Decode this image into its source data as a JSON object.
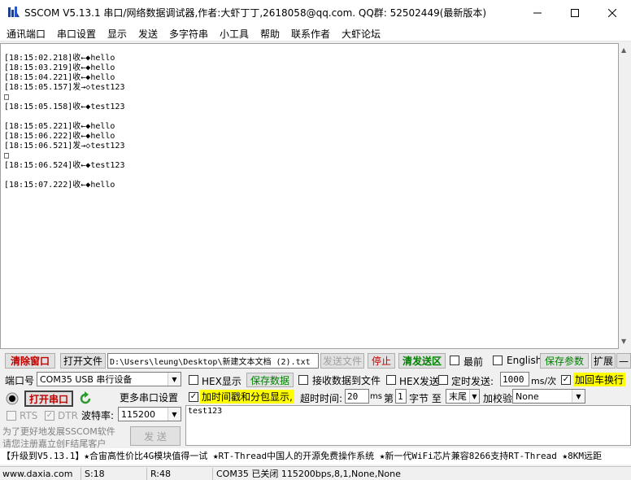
{
  "window": {
    "title": "SSCOM V5.13.1 串口/网络数据调试器,作者:大虾丁丁,2618058@qq.com. QQ群: 52502449(最新版本)",
    "minimize_icon": "minimize-icon",
    "maximize_icon": "maximize-icon",
    "close_icon": "close-icon"
  },
  "menu": [
    "通讯端口",
    "串口设置",
    "显示",
    "发送",
    "多字符串",
    "小工具",
    "帮助",
    "联系作者",
    "大虾论坛"
  ],
  "receive_lines": [
    "[18:15:02.218]收←◆hello",
    "[18:15:03.219]收←◆hello",
    "[18:15:04.221]收←◆hello",
    "[18:15:05.157]发→◇test123",
    "□",
    "[18:15:05.158]收←◆test123",
    "",
    "[18:15:05.221]收←◆hello",
    "[18:15:06.222]收←◆hello",
    "[18:15:06.521]发→◇test123",
    "□",
    "[18:15:06.524]收←◆test123",
    "",
    "[18:15:07.222]收←◆hello"
  ],
  "toolbar": {
    "clear_window": "清除窗口",
    "open_file": "打开文件",
    "file_path": "D:\\Users\\leung\\Desktop\\新建文本文档 (2).txt",
    "send_file": "发送文件",
    "stop": "停止",
    "clear_send": "清发送区",
    "topmost": "最前",
    "english": "English",
    "save_params": "保存参数",
    "expand": "扩展",
    "collapse": "—"
  },
  "port": {
    "port_label": "端口号",
    "port_value": "COM35 USB 串行设备",
    "open_port": "打开串口",
    "more_settings": "更多串口设置",
    "rts": "RTS",
    "dtr": "DTR",
    "baud_label": "波特率:",
    "baud_value": "115200",
    "promo_line1": "为了更好地发展SSCOM软件",
    "promo_line2": "请您注册嘉立创F结尾客户"
  },
  "options": {
    "hex_display": "HEX显示",
    "save_data": "保存数据",
    "recv_to_file": "接收数据到文件",
    "hex_send": "HEX发送",
    "timed_send": "定时发送:",
    "interval": "1000",
    "interval_unit": "ms/次",
    "add_crlf": "加回车换行",
    "timestamp_split": "加时间戳和分包显示,",
    "timeout_label": "超时时间:",
    "timeout_value": "20",
    "timeout_unit": "ms",
    "byte_prefix": "第",
    "byte_index": "1",
    "byte_unit": "字节 至",
    "byte_end": "末尾",
    "checksum_label": "加校验",
    "checksum_value": "None"
  },
  "send": {
    "text": "test123",
    "send_button": "发 送"
  },
  "ticker": "【升级到V5.13.1】★合宙高性价比4G模块值得一试 ★RT-Thread中国人的开源免费操作系统 ★新一代WiFi芯片兼容8266支持RT-Thread ★8KM远距",
  "status": {
    "website": "www.daxia.com",
    "sent": "S:18",
    "received": "R:48",
    "port_state": "COM35 已关闭  115200bps,8,1,None,None"
  },
  "colors": {
    "accent_red": "#c00000",
    "accent_green": "#008000",
    "highlight_yellow": "#ffff00"
  }
}
